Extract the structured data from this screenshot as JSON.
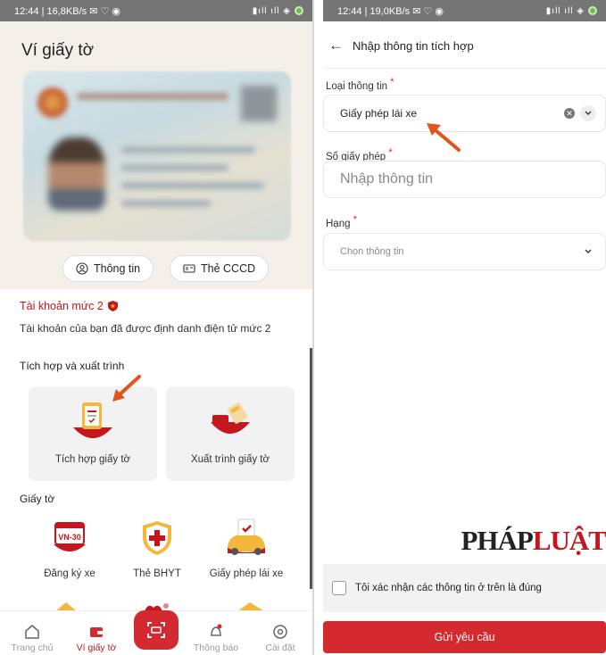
{
  "left": {
    "status": {
      "time_info": "12:44 | 16,8KB/s",
      "icons": "✉ ♡ ◉",
      "signal": "▮ıll ıll ◈"
    },
    "title": "Ví giấy tờ",
    "card_buttons": {
      "info": "Thông tin",
      "cccd": "Thẻ CCCD"
    },
    "account": {
      "level": "Tài khoản mức 2",
      "desc": "Tài khoản của bạn đã được định danh điện tử mức 2"
    },
    "integrate_section": "Tích hợp và xuất trình",
    "tiles": {
      "integrate": "Tích hợp giấy tờ",
      "present": "Xuất trình giấy tờ"
    },
    "documents_section": "Giấy tờ",
    "documents": {
      "vehicle": "Đăng ký xe",
      "vehicle_plate": "VN-30",
      "insurance": "Thẻ BHYT",
      "license": "Giấy phép lái xe"
    },
    "nav": {
      "home": "Trang chủ",
      "wallet": "Ví giấy tờ",
      "notify": "Thông báo",
      "settings": "Cài đặt"
    }
  },
  "right": {
    "status": {
      "time_info": "12:44 | 19,0KB/s",
      "icons": "✉ ♡ ◉",
      "signal": "▮ıll ıll ◈"
    },
    "header": {
      "back": "←",
      "title": "Nhập thông tin tích hợp"
    },
    "info_type": {
      "label": "Loại thông tin",
      "value": "Giấy phép lái xe"
    },
    "license_no": {
      "label": "Số giấy phép",
      "placeholder": "Nhập thông tin"
    },
    "class": {
      "label": "Hạng",
      "placeholder": "Chọn thông tin"
    },
    "required": "*",
    "watermark": {
      "a": "PHÁP",
      "b": "LUẬT"
    },
    "confirm_text": "Tôi xác nhận các thông tin ở trên là đúng",
    "submit": "Gửi yêu cầu"
  },
  "colors": {
    "brand_red": "#d42a2f",
    "header_bg": "#f5efe9",
    "status_bar": "#757575"
  }
}
